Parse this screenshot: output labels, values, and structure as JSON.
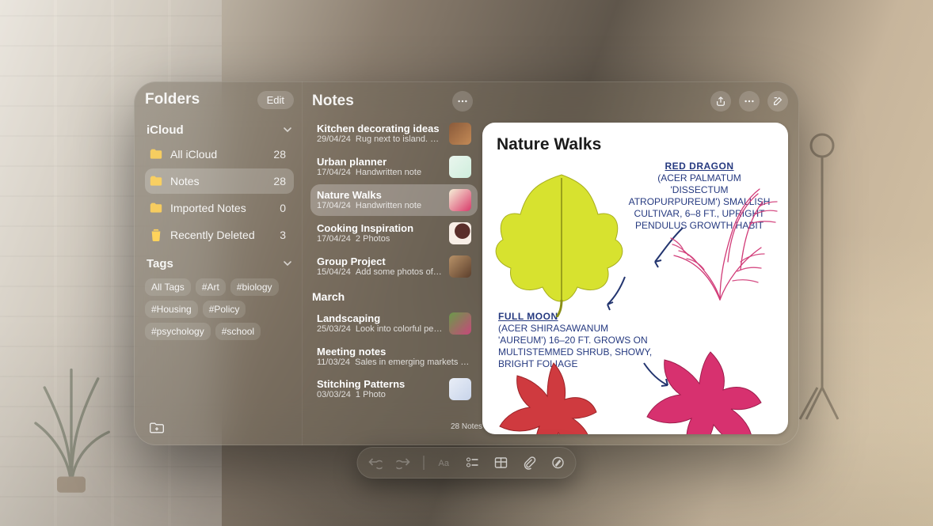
{
  "sidebar": {
    "title": "Folders",
    "edit": "Edit",
    "sections": [
      {
        "name": "iCloud",
        "folders": [
          {
            "icon": "folder",
            "label": "All iCloud",
            "count": "28",
            "selected": false
          },
          {
            "icon": "folder",
            "label": "Notes",
            "count": "28",
            "selected": true
          },
          {
            "icon": "folder",
            "label": "Imported Notes",
            "count": "0",
            "selected": false
          },
          {
            "icon": "trash",
            "label": "Recently Deleted",
            "count": "3",
            "selected": false
          }
        ]
      }
    ],
    "tags_heading": "Tags",
    "tags": [
      "All Tags",
      "#Art",
      "#biology",
      "#Housing",
      "#Policy",
      "#psychology",
      "#school"
    ]
  },
  "notelist": {
    "title": "Notes",
    "footer": "28 Notes",
    "groups": [
      {
        "heading": null,
        "notes": [
          {
            "title": "Kitchen decorating ideas",
            "date": "29/04/24",
            "sub": "Rug next to island. Conte…",
            "thumb": "th-brown"
          },
          {
            "title": "Urban planner",
            "date": "17/04/24",
            "sub": "Handwritten note",
            "thumb": "th-plan"
          },
          {
            "title": "Nature Walks",
            "date": "17/04/24",
            "sub": "Handwritten note",
            "thumb": "th-nature",
            "selected": true
          },
          {
            "title": "Cooking Inspiration",
            "date": "17/04/24",
            "sub": "2 Photos",
            "thumb": "th-cook"
          },
          {
            "title": "Group Project",
            "date": "15/04/24",
            "sub": "Add some photos of their…",
            "thumb": "th-group"
          }
        ]
      },
      {
        "heading": "March",
        "notes": [
          {
            "title": "Landscaping",
            "date": "25/03/24",
            "sub": "Look into colorful perenn…",
            "thumb": "th-land"
          },
          {
            "title": "Meeting notes",
            "date": "11/03/24",
            "sub": "Sales in emerging markets are tr…",
            "thumb": null
          },
          {
            "title": "Stitching Patterns",
            "date": "03/03/24",
            "sub": "1 Photo",
            "thumb": "th-stitch"
          }
        ]
      }
    ]
  },
  "detail": {
    "title": "Nature Walks",
    "anno_top": {
      "under": "RED DRAGON",
      "body": "(ACER PALMATUM 'DISSECTUM ATROPURPUREUM') SMALLISH CULTIVAR, 6–8 FT., UPRIGHT PENDULUS GROWTH HABIT"
    },
    "anno_bottom": {
      "under": "FULL MOON",
      "body": "(ACER SHIRASAWANUM 'AUREUM') 16–20 FT. GROWS ON MULTISTEMMED SHRUB, SHOWY, BRIGHT FOLIAGE"
    }
  },
  "toolbar": [
    "undo",
    "redo",
    "|",
    "format",
    "checklist",
    "table",
    "attach",
    "markup"
  ]
}
